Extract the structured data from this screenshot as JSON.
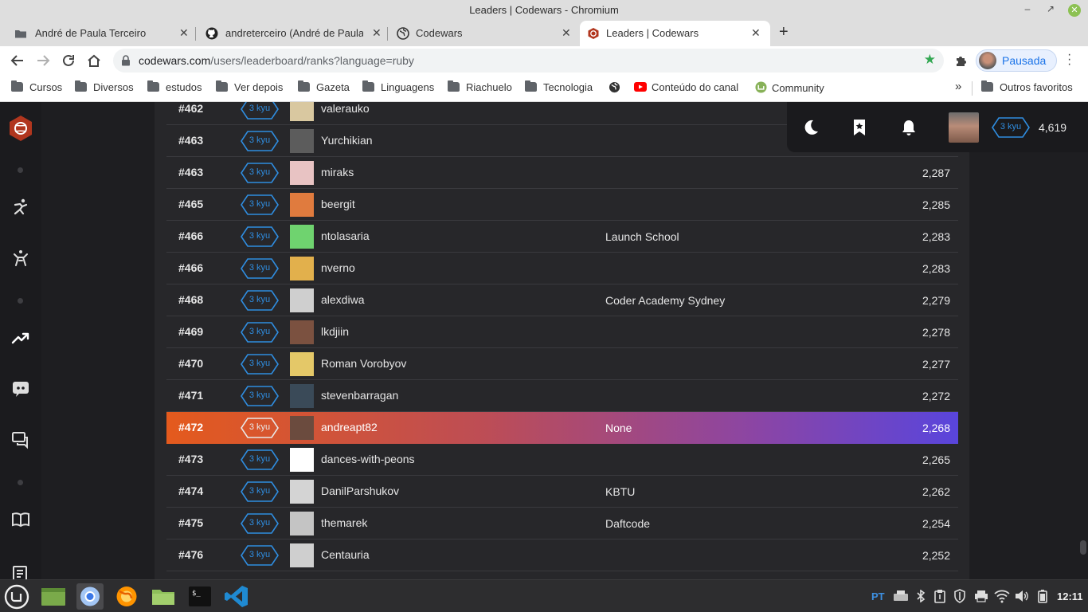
{
  "window": {
    "title": "Leaders | Codewars - Chromium"
  },
  "tabs": [
    {
      "label": "André de Paula Terceiro",
      "icon": "folder-icon"
    },
    {
      "label": "andreterceiro (André de Paula",
      "icon": "github-icon"
    },
    {
      "label": "Codewars",
      "icon": "globe-icon"
    },
    {
      "label": "Leaders | Codewars",
      "icon": "codewars-icon",
      "active": true
    }
  ],
  "address": {
    "host": "codewars.com",
    "path": "/users/leaderboard/ranks?language=ruby"
  },
  "profile": {
    "label": "Pausada"
  },
  "bookmarks": [
    {
      "label": "Cursos",
      "icon": "folder-icon"
    },
    {
      "label": "Diversos",
      "icon": "folder-icon"
    },
    {
      "label": "estudos",
      "icon": "folder-icon"
    },
    {
      "label": "Ver depois",
      "icon": "folder-icon"
    },
    {
      "label": "Gazeta",
      "icon": "folder-icon"
    },
    {
      "label": "Linguagens",
      "icon": "folder-icon"
    },
    {
      "label": "Riachuelo",
      "icon": "folder-icon"
    },
    {
      "label": "Tecnologia",
      "icon": "folder-icon"
    },
    {
      "label": "",
      "icon": "globe-icon"
    },
    {
      "label": "Conteúdo do canal",
      "icon": "youtube-icon"
    },
    {
      "label": "Community",
      "icon": "mint-icon"
    }
  ],
  "bookmarks_overflow": "»",
  "other_bookmarks": "Outros favoritos",
  "userbar": {
    "rank": "3 kyu",
    "honor": "4,619"
  },
  "leaderboard": {
    "rows": [
      {
        "position": "#462",
        "rank": "3 kyu",
        "username": "valerauko",
        "clan": "",
        "honor": ""
      },
      {
        "position": "#463",
        "rank": "3 kyu",
        "username": "Yurchikian",
        "clan": "",
        "honor": ""
      },
      {
        "position": "#463",
        "rank": "3 kyu",
        "username": "miraks",
        "clan": "",
        "honor": "2,287"
      },
      {
        "position": "#465",
        "rank": "3 kyu",
        "username": "beergit",
        "clan": "",
        "honor": "2,285"
      },
      {
        "position": "#466",
        "rank": "3 kyu",
        "username": "ntolasaria",
        "clan": "Launch School",
        "honor": "2,283"
      },
      {
        "position": "#466",
        "rank": "3 kyu",
        "username": "nverno",
        "clan": "",
        "honor": "2,283"
      },
      {
        "position": "#468",
        "rank": "3 kyu",
        "username": "alexdiwa",
        "clan": "Coder Academy Sydney",
        "honor": "2,279"
      },
      {
        "position": "#469",
        "rank": "3 kyu",
        "username": "lkdjiin",
        "clan": "",
        "honor": "2,278"
      },
      {
        "position": "#470",
        "rank": "3 kyu",
        "username": "Roman Vorobyov",
        "clan": "",
        "honor": "2,277"
      },
      {
        "position": "#471",
        "rank": "3 kyu",
        "username": "stevenbarragan",
        "clan": "",
        "honor": "2,272"
      },
      {
        "position": "#472",
        "rank": "3 kyu",
        "username": "andreapt82",
        "clan": "None",
        "honor": "2,268",
        "current_user": true
      },
      {
        "position": "#473",
        "rank": "3 kyu",
        "username": "dances-with-peons",
        "clan": "",
        "honor": "2,265"
      },
      {
        "position": "#474",
        "rank": "3 kyu",
        "username": "DanilParshukov",
        "clan": "KBTU",
        "honor": "2,262"
      },
      {
        "position": "#475",
        "rank": "3 kyu",
        "username": "themarek",
        "clan": "Daftcode",
        "honor": "2,254"
      },
      {
        "position": "#476",
        "rank": "3 kyu",
        "username": "Centauria",
        "clan": "",
        "honor": "2,252"
      }
    ]
  },
  "taskbar": {
    "keyboard_layout": "PT",
    "clock": "12:11"
  },
  "colors": {
    "accent": "#b1361e",
    "kyu_blue": "#2f8de0",
    "page_bg": "#1e1e21",
    "panel_bg": "#27272a"
  }
}
